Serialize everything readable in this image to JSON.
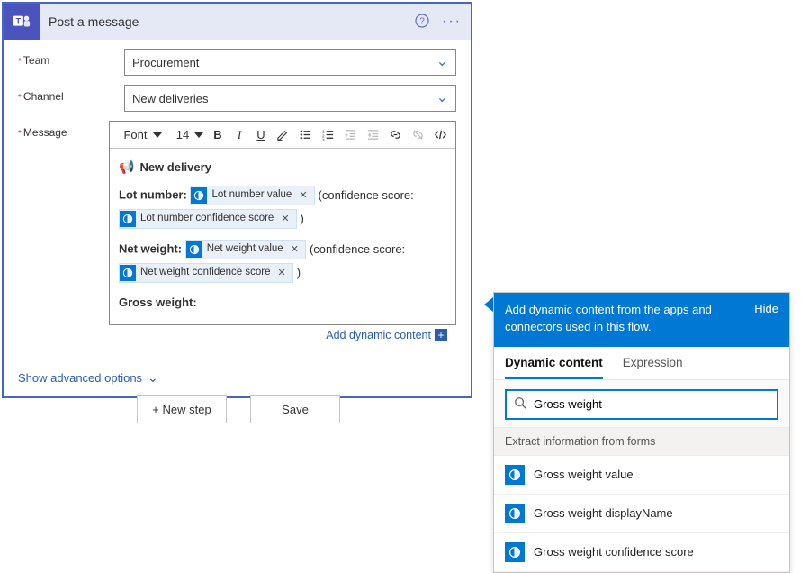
{
  "card": {
    "title": "Post a message",
    "fields": {
      "team": {
        "label": "Team",
        "value": "Procurement"
      },
      "channel": {
        "label": "Channel",
        "value": "New deliveries"
      },
      "message": {
        "label": "Message"
      }
    },
    "toolbar": {
      "font_label": "Font",
      "font_size": "14"
    },
    "message_body": {
      "heading": "New delivery",
      "lot_label": "Lot number:",
      "lot_value_token": "Lot number value",
      "confidence_open": "(confidence score:",
      "lot_conf_token": "Lot number confidence score",
      "paren_close": ")",
      "net_label": "Net weight:",
      "net_value_token": "Net weight value",
      "net_conf_token": "Net weight confidence score",
      "gross_label": "Gross weight:"
    },
    "add_dynamic": "Add dynamic content",
    "advanced": "Show advanced options"
  },
  "footer": {
    "new_step": "+ New step",
    "save": "Save"
  },
  "panel": {
    "header_text": "Add dynamic content from the apps and connectors used in this flow.",
    "hide": "Hide",
    "tabs": {
      "dynamic": "Dynamic content",
      "expression": "Expression"
    },
    "search_value": "Gross weight",
    "group": "Extract information from forms",
    "results": [
      "Gross weight value",
      "Gross weight displayName",
      "Gross weight confidence score"
    ]
  }
}
